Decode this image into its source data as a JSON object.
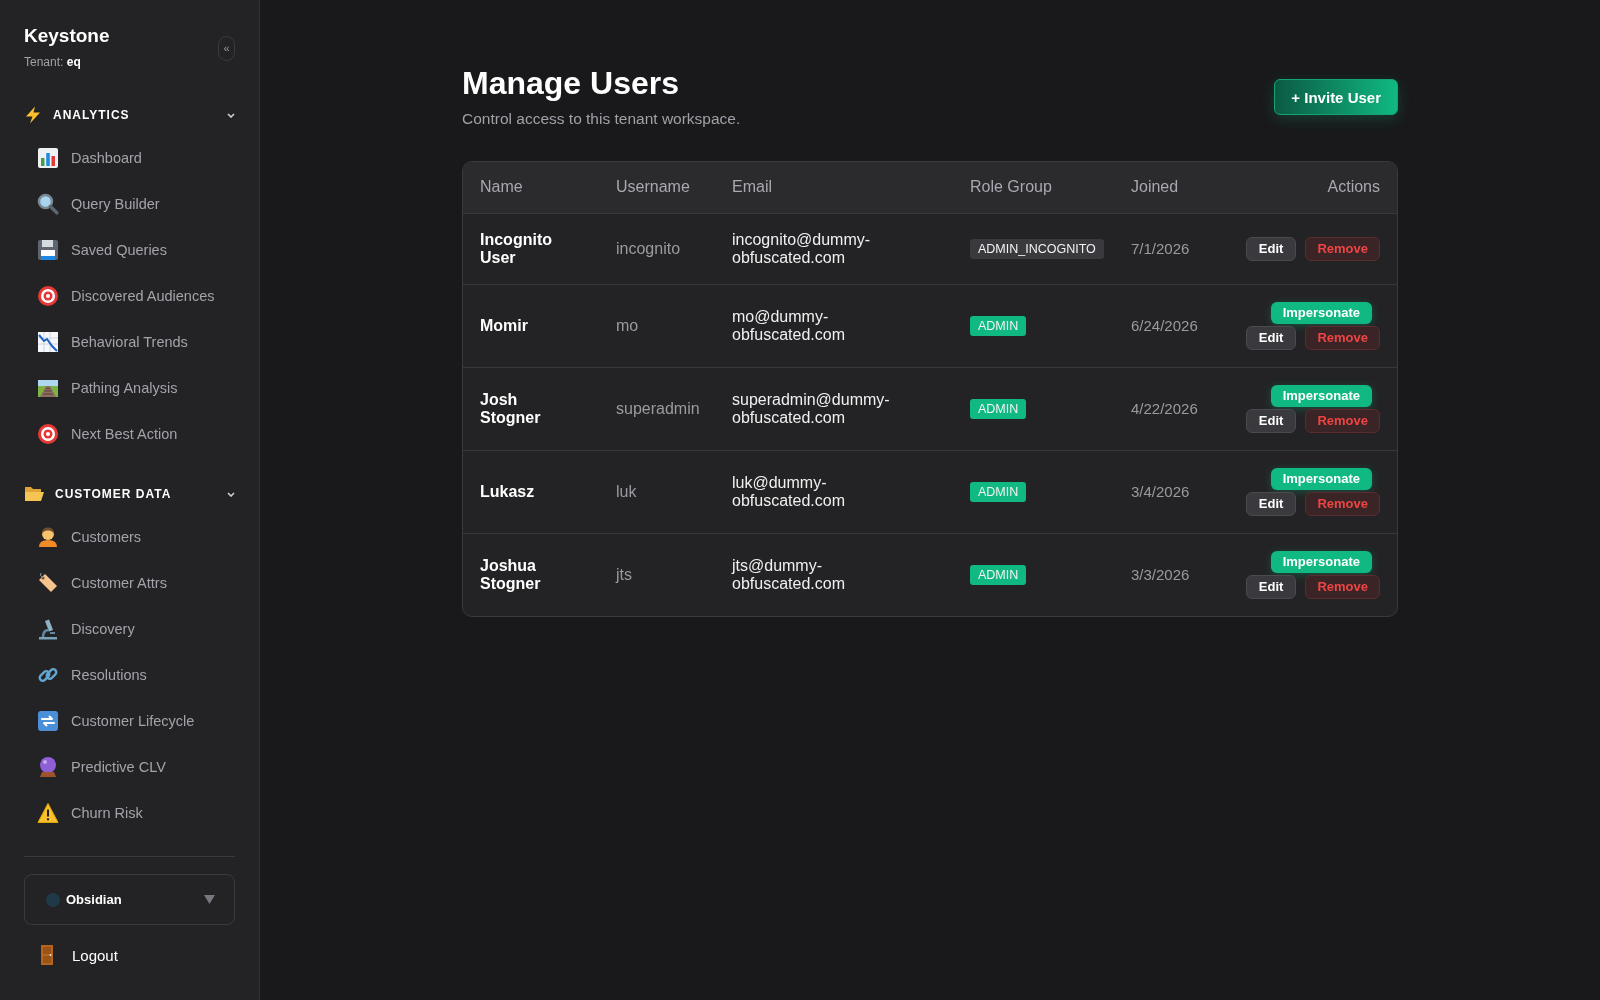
{
  "sidebar": {
    "brand": "Keystone",
    "tenant": "Tenant: **eq**",
    "collapse_button": "«",
    "sections": [
      {
        "title": "ANALYTICS",
        "expanded": true,
        "items": [
          {
            "label": "Dashboard",
            "selected": false
          },
          {
            "label": "Query Builder",
            "selected": false
          },
          {
            "label": "Saved Queries",
            "selected": false
          },
          {
            "label": "Discovered Audiences",
            "selected": false
          },
          {
            "label": "Behavioral Trends",
            "selected": false
          },
          {
            "label": "Pathing Analysis",
            "selected": false
          },
          {
            "label": "Next Best Action",
            "selected": false
          }
        ]
      },
      {
        "title": "CUSTOMER DATA",
        "expanded": true,
        "items": [
          {
            "label": "Customers",
            "selected": false
          },
          {
            "label": "Customer Attrs",
            "selected": false
          },
          {
            "label": "Discovery",
            "selected": false
          },
          {
            "label": "Resolutions",
            "selected": false
          },
          {
            "label": "Customer Lifecycle",
            "selected": false
          },
          {
            "label": "Predictive CLV",
            "selected": false
          },
          {
            "label": "Churn Risk",
            "selected": false
          }
        ]
      }
    ],
    "theme_select": {
      "value": "Obsidian"
    },
    "logout": "Logout"
  },
  "page": {
    "title": "Manage Users",
    "subtitle": "Control access to this tenant workspace.",
    "invite_button": "+ Invite User"
  },
  "table": {
    "columns": [
      "Name",
      "Username",
      "Email",
      "Role Group",
      "Joined",
      "Actions"
    ],
    "rows": [
      {
        "name": "Incognito User",
        "username": "incognito",
        "email": "incognito@dummy-obfuscated.com",
        "role": {
          "label": "ADMIN_INCOGNITO",
          "color": "#3a3a3e"
        },
        "joined": "7/1/2026",
        "actions": [
          {
            "kind": "edit",
            "label": "Edit"
          },
          {
            "kind": "remove",
            "label": "Remove"
          }
        ]
      },
      {
        "name": "Momir",
        "username": "mo",
        "email": "mo@dummy-obfuscated.com",
        "role": {
          "label": "ADMIN",
          "color": "#10b981"
        },
        "joined": "6/24/2026",
        "actions": [
          {
            "kind": "impersonate",
            "label": "Impersonate"
          },
          {
            "kind": "edit",
            "label": "Edit"
          },
          {
            "kind": "remove",
            "label": "Remove"
          }
        ]
      },
      {
        "name": "Josh Stogner",
        "username": "superadmin",
        "email": "superadmin@dummy-obfuscated.com",
        "role": {
          "label": "ADMIN",
          "color": "#10b981"
        },
        "joined": "4/22/2026",
        "actions": [
          {
            "kind": "impersonate",
            "label": "Impersonate"
          },
          {
            "kind": "edit",
            "label": "Edit"
          },
          {
            "kind": "remove",
            "label": "Remove"
          }
        ]
      },
      {
        "name": "Lukasz",
        "username": "luk",
        "email": "luk@dummy-obfuscated.com",
        "role": {
          "label": "ADMIN",
          "color": "#10b981"
        },
        "joined": "3/4/2026",
        "actions": [
          {
            "kind": "impersonate",
            "label": "Impersonate"
          },
          {
            "kind": "edit",
            "label": "Edit"
          },
          {
            "kind": "remove",
            "label": "Remove"
          }
        ]
      },
      {
        "name": "Joshua Stogner",
        "username": "jts",
        "email": "jts@dummy-obfuscated.com",
        "role": {
          "label": "ADMIN",
          "color": "#10b981"
        },
        "joined": "3/3/2026",
        "actions": [
          {
            "kind": "impersonate",
            "label": "Impersonate"
          },
          {
            "kind": "edit",
            "label": "Edit"
          },
          {
            "kind": "remove",
            "label": "Remove"
          }
        ]
      }
    ]
  }
}
